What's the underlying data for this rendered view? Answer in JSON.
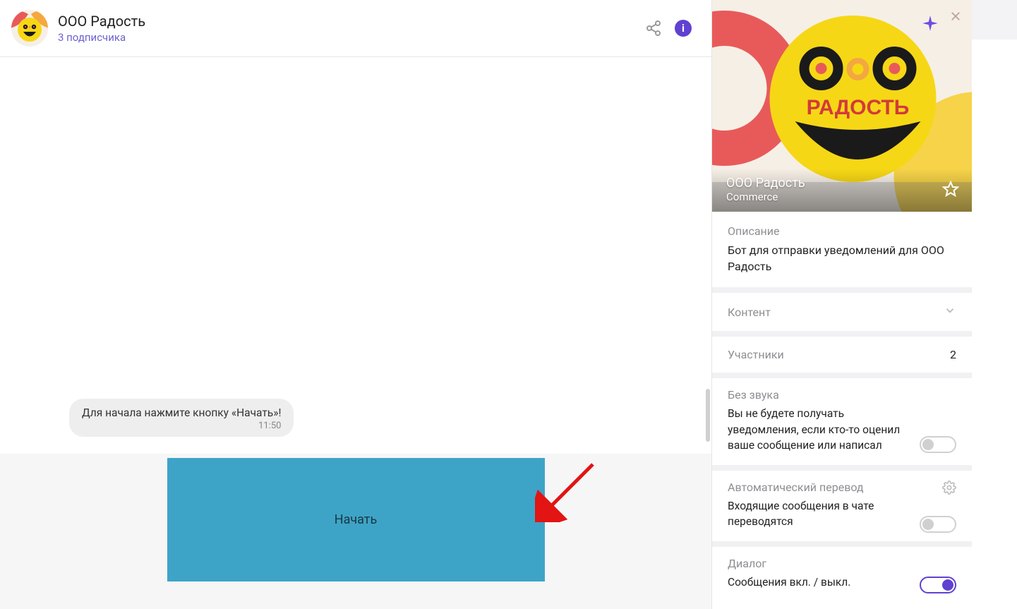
{
  "header": {
    "title": "ООО Радость",
    "subscribers": "3 подписчика"
  },
  "chat": {
    "message_text": "Для начала нажмите кнопку «Начать»!",
    "message_time": "11:50",
    "start_button": "Начать"
  },
  "panel": {
    "title": "ООО Радость",
    "category": "Commerce",
    "brand_text": "РАДОСТЬ",
    "description_label": "Описание",
    "description_text": "Бот для отправки уведомлений для ООО Радость",
    "content_label": "Контент",
    "participants_label": "Участники",
    "participants_count": "2",
    "mute": {
      "label": "Без звука",
      "text": "Вы не будете получать уведомления, если кто-то оценил ваше сообщение или написал"
    },
    "translate": {
      "label": "Автоматический перевод",
      "text": "Входящие сообщения в чате переводятся"
    },
    "dialog": {
      "label": "Диалог",
      "text": "Сообщения вкл. / выкл."
    }
  }
}
